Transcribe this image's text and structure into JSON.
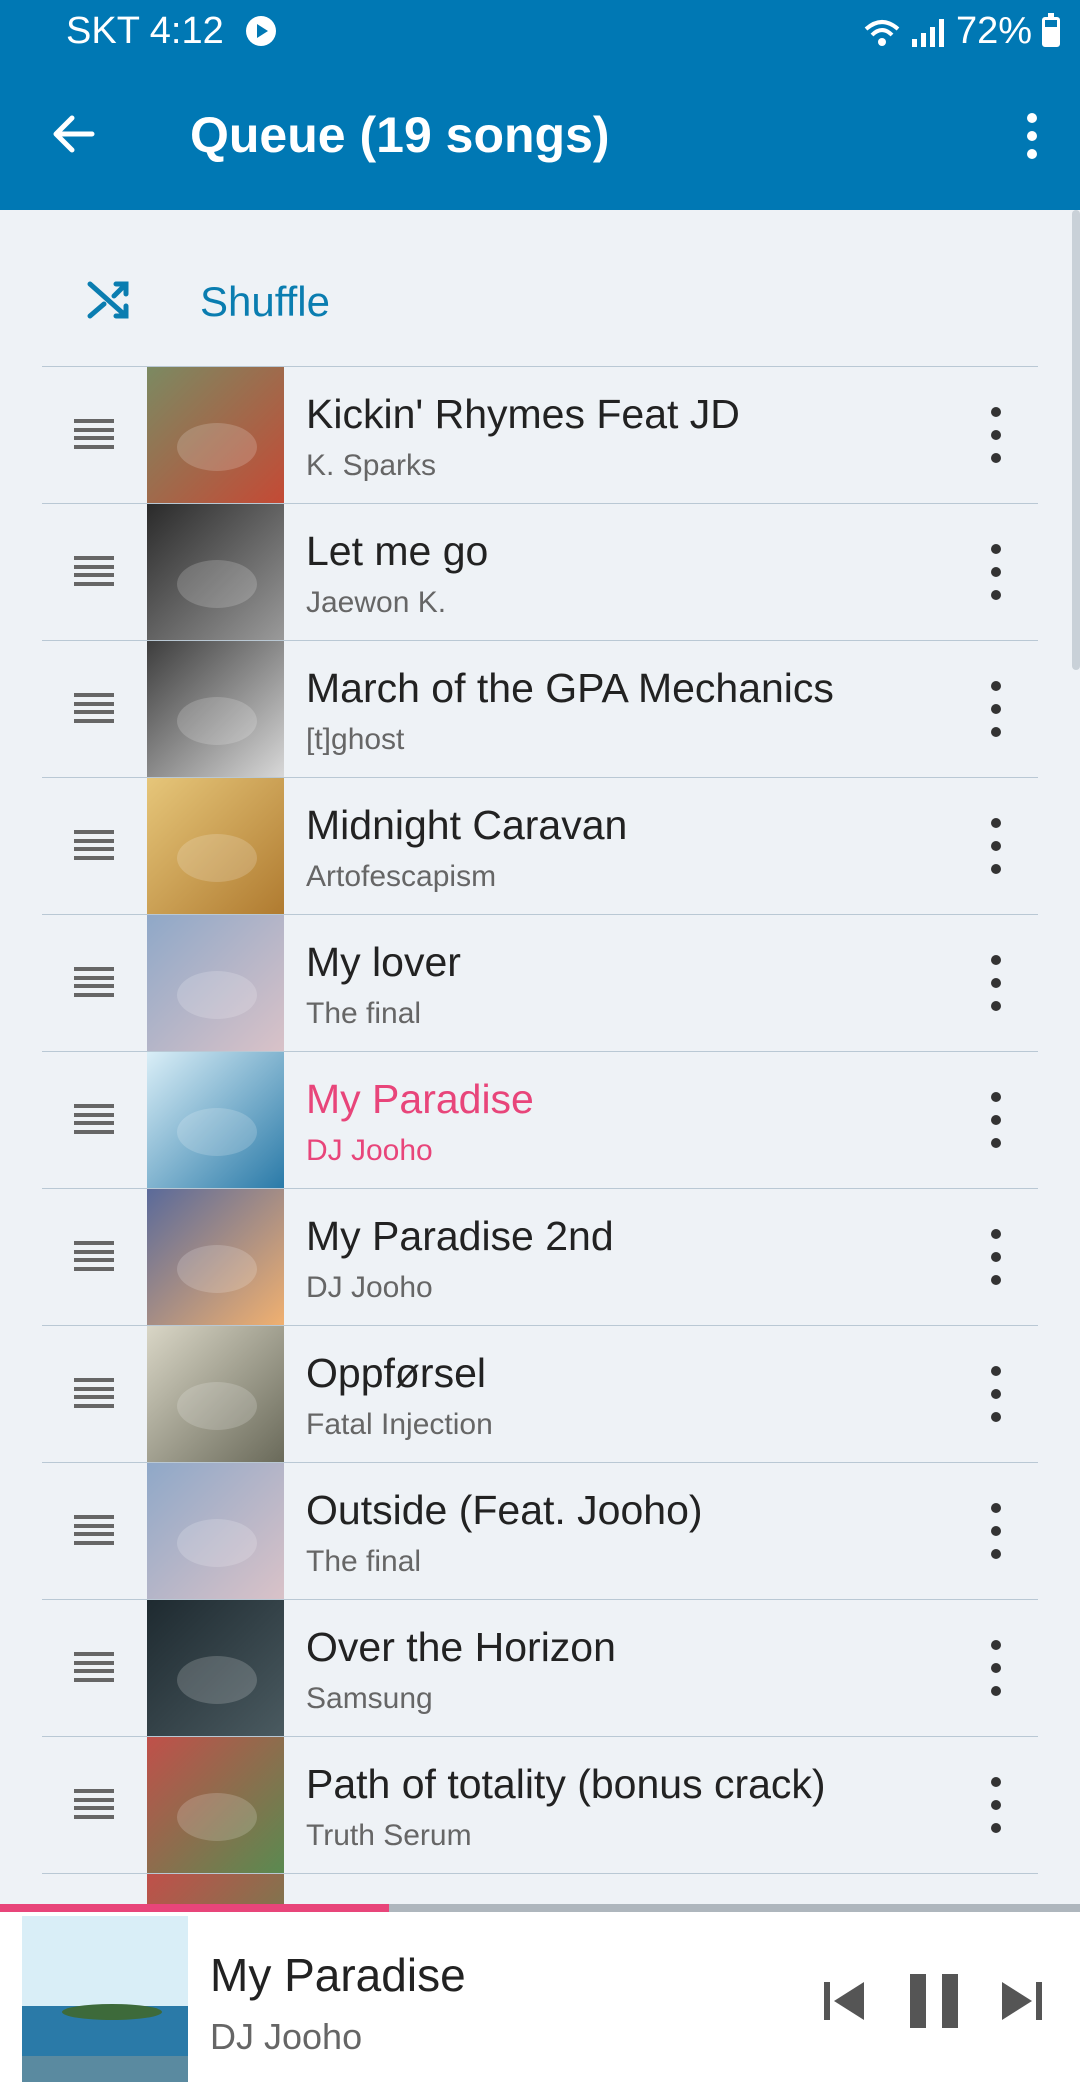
{
  "status": {
    "carrier_time": "SKT 4:12",
    "battery": "72%"
  },
  "appbar": {
    "title": "Queue (19 songs)"
  },
  "shuffle": {
    "label": "Shuffle"
  },
  "queue": [
    {
      "title": "Kickin' Rhymes Feat JD",
      "artist": "K. Sparks",
      "art_colors": [
        "#7b8a62",
        "#c44a35"
      ]
    },
    {
      "title": "Let me go",
      "artist": "Jaewon K.",
      "art_colors": [
        "#2a2a2a",
        "#9a9a9a"
      ]
    },
    {
      "title": "March of the GPA Mechanics",
      "artist": "[t]ghost",
      "art_colors": [
        "#3d3d3d",
        "#d8d8d8"
      ]
    },
    {
      "title": "Midnight Caravan",
      "artist": "Artofescapism",
      "art_colors": [
        "#e6c67a",
        "#b07b30"
      ]
    },
    {
      "title": "My lover",
      "artist": "The final",
      "art_colors": [
        "#8fa8c8",
        "#d9c2c8"
      ]
    },
    {
      "title": "My Paradise",
      "artist": "DJ Jooho",
      "art_colors": [
        "#d9eef7",
        "#2a7aa8"
      ],
      "current": true
    },
    {
      "title": "My Paradise 2nd",
      "artist": "DJ Jooho",
      "art_colors": [
        "#5a6a9a",
        "#f0b070"
      ]
    },
    {
      "title": "Oppførsel",
      "artist": "Fatal Injection",
      "art_colors": [
        "#d9d6c6",
        "#6a6a5a"
      ]
    },
    {
      "title": "Outside (Feat. Jooho)",
      "artist": "The final",
      "art_colors": [
        "#8fa8c8",
        "#d9c2c8"
      ]
    },
    {
      "title": "Over the Horizon",
      "artist": "Samsung",
      "art_colors": [
        "#1e2a30",
        "#4a5a60"
      ]
    },
    {
      "title": "Path of totality (bonus crack)",
      "artist": "Truth Serum",
      "art_colors": [
        "#c0504a",
        "#5a8a50"
      ]
    },
    {
      "title": "",
      "artist": "",
      "art_colors": [
        "#c0504a",
        "#5a8a50"
      ]
    }
  ],
  "now_playing": {
    "title": "My Paradise",
    "artist": "DJ Jooho",
    "progress_fraction": 0.36
  },
  "colors": {
    "accent": "#0078b4",
    "highlight": "#e8457a"
  }
}
